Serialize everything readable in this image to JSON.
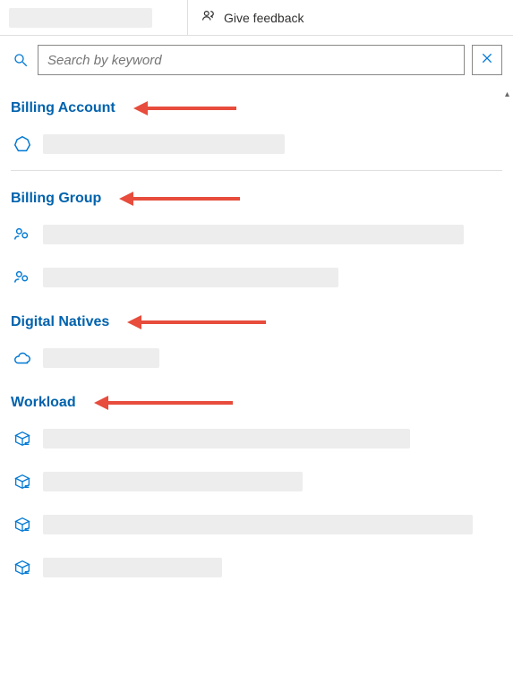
{
  "topbar": {
    "feedback_label": "Give feedback"
  },
  "search": {
    "placeholder": "Search by keyword",
    "value": ""
  },
  "sections": {
    "billing_account": {
      "title": "Billing Account"
    },
    "billing_group": {
      "title": "Billing Group"
    },
    "digital_natives": {
      "title": "Digital Natives"
    },
    "workload": {
      "title": "Workload"
    }
  }
}
